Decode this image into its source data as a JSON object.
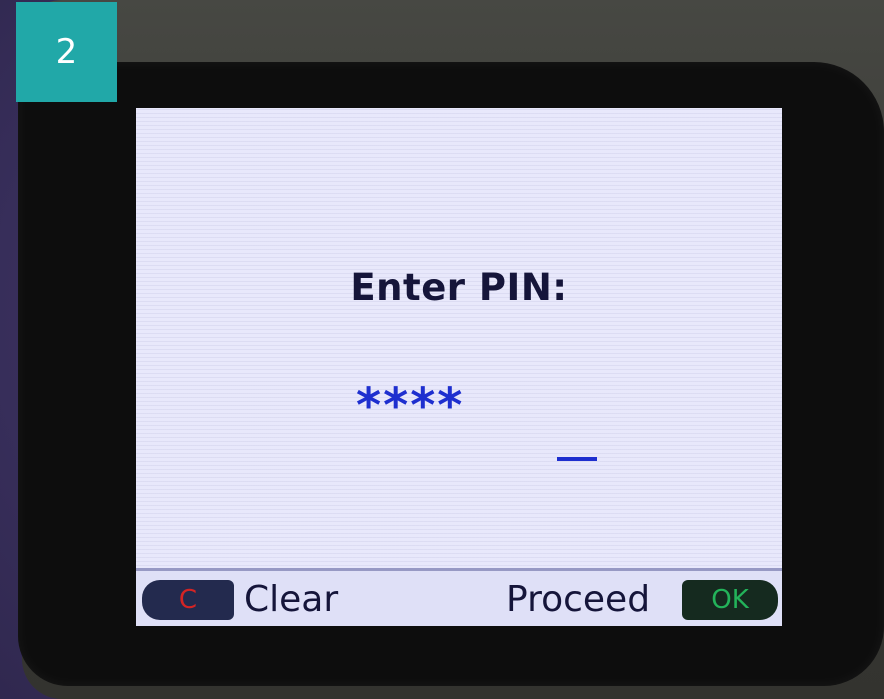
{
  "step_badge": {
    "label": "2",
    "color": "#21a8a8"
  },
  "display": {
    "prompt": "Enter PIN:",
    "pin_mask": "****",
    "pin_color": "#1e2fcf"
  },
  "softkeys": {
    "clear_key": "C",
    "clear_label": "Clear",
    "proceed_label": "Proceed",
    "ok_key": "OK",
    "clear_key_color": "#d42424",
    "ok_key_color": "#23b35a"
  }
}
